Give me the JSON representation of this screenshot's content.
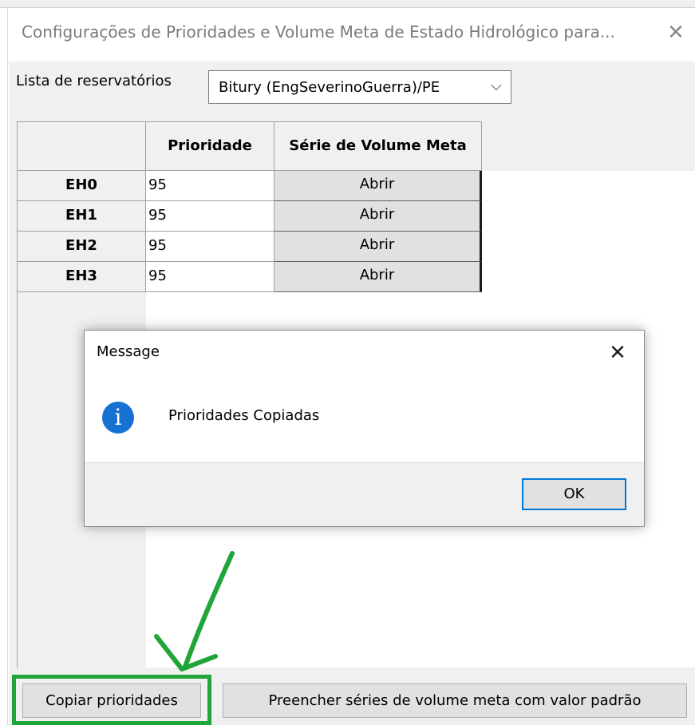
{
  "window": {
    "title": "Configurações de Prioridades e Volume Meta de Estado Hidrológico para...",
    "close_glyph": "✕"
  },
  "reservoir": {
    "label": "Lista de reservatórios",
    "selected": "Bitury (EngSeverinoGuerra)/PE",
    "chevron": "⌵"
  },
  "grid": {
    "columns": [
      "Prioridade",
      "Série de Volume Meta"
    ],
    "rows": [
      {
        "name": "EH0",
        "prioridade": "95",
        "button": "Abrir"
      },
      {
        "name": "EH1",
        "prioridade": "95",
        "button": "Abrir"
      },
      {
        "name": "EH2",
        "prioridade": "95",
        "button": "Abrir"
      },
      {
        "name": "EH3",
        "prioridade": "95",
        "button": "Abrir"
      }
    ]
  },
  "message": {
    "title": "Message",
    "text": "Prioridades Copiadas",
    "ok": "OK",
    "close_glyph": "✕",
    "icon_glyph": "i"
  },
  "buttons": {
    "copy": "Copiar prioridades",
    "fill": "Preencher séries de volume meta com valor padrão"
  },
  "colors": {
    "annotation_green": "#21a538",
    "info_blue": "#1571d2",
    "focus_blue": "#0078d7"
  }
}
